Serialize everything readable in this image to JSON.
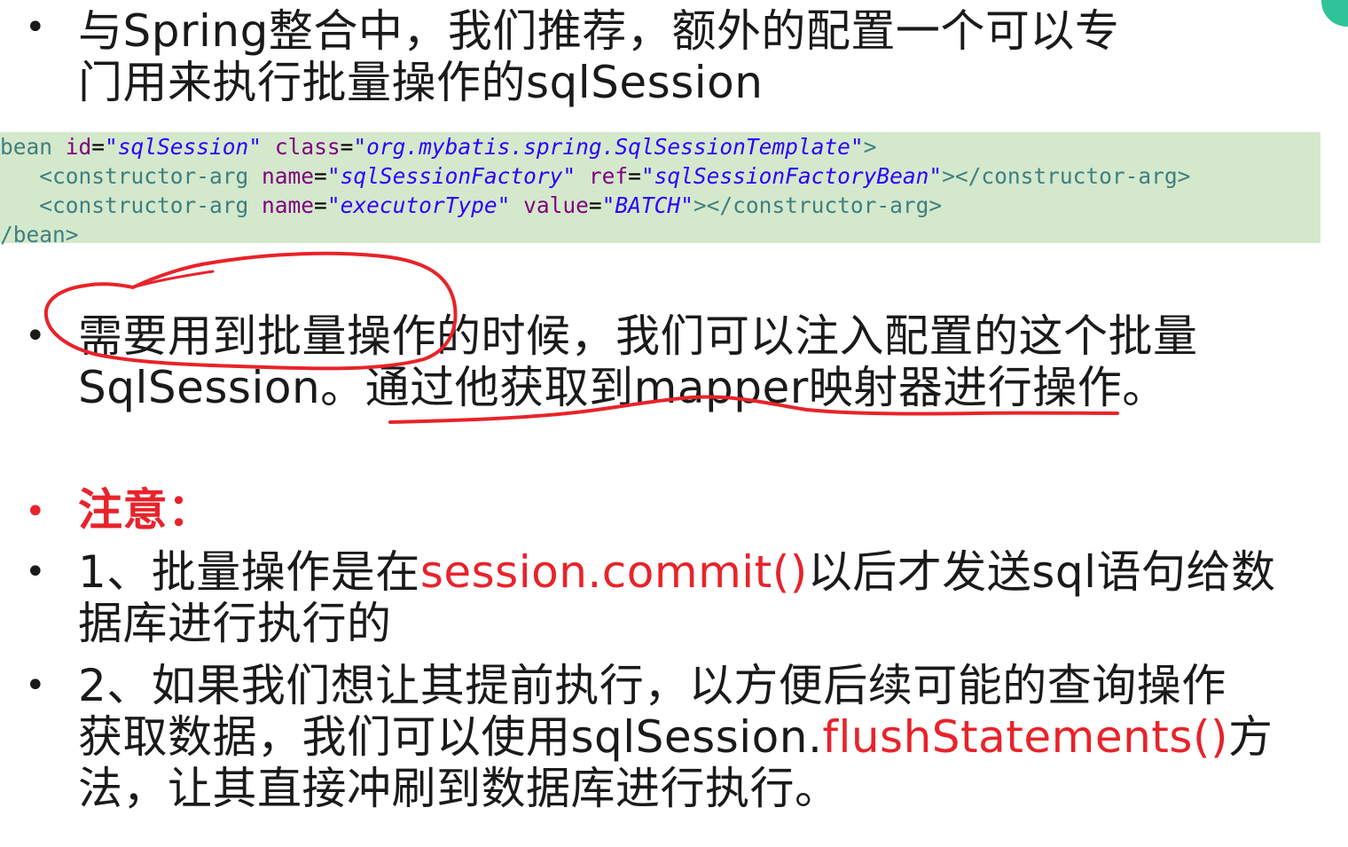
{
  "bullet_symbol": "•",
  "intro": {
    "line1": "与Spring整合中，我们推荐，额外的配置一个可以专",
    "line2": "门用来执行批量操作的sqlSession"
  },
  "code": {
    "line1": {
      "open": "bean ",
      "attr1": "id",
      "eq1": "=",
      "val1": "\"sqlSession\"",
      "sp1": " ",
      "attr2": "class",
      "eq2": "=",
      "val2": "\"org.mybatis.spring.SqlSessionTemplate\"",
      "close": ">"
    },
    "line2": {
      "indent": "   ",
      "open": "<constructor-arg ",
      "attr1": "name",
      "eq1": "=",
      "val1": "\"sqlSessionFactory\"",
      "sp1": " ",
      "attr2": "ref",
      "eq2": "=",
      "val2": "\"sqlSessionFactoryBean\"",
      "close": "></constructor-arg>"
    },
    "line3": {
      "indent": "   ",
      "open": "<constructor-arg ",
      "attr1": "name",
      "eq1": "=",
      "val1": "\"executorType\"",
      "sp1": " ",
      "attr2": "value",
      "eq2": "=",
      "val2": "\"BATCH\"",
      "close": "></constructor-arg>"
    },
    "line4": "/bean>"
  },
  "inject": {
    "line1": "需要用到批量操作的时候，我们可以注入配置的这个批量",
    "line2": "SqlSession。通过他获取到mapper映射器进行操作。"
  },
  "note": {
    "heading": "注意："
  },
  "point1": {
    "prefix": "1、批量操作是在",
    "code": "session.commit()",
    "suffix": "以后才发送sql语句给数",
    "line2": "据库进行执行的"
  },
  "point2": {
    "line1": "2、如果我们想让其提前执行，以方便后续可能的查询操作",
    "line2_prefix": "获取数据，我们可以使用sqlSession.",
    "line2_code": "flushStatements()",
    "line2_suffix": "方",
    "line3": "法，让其直接冲刷到数据库进行执行。"
  },
  "colors": {
    "accent_red": "#e8232a",
    "code_background": "#d4e8cc",
    "ink_annotation": "#e8232a",
    "corner_accent": "#2fc39a"
  }
}
